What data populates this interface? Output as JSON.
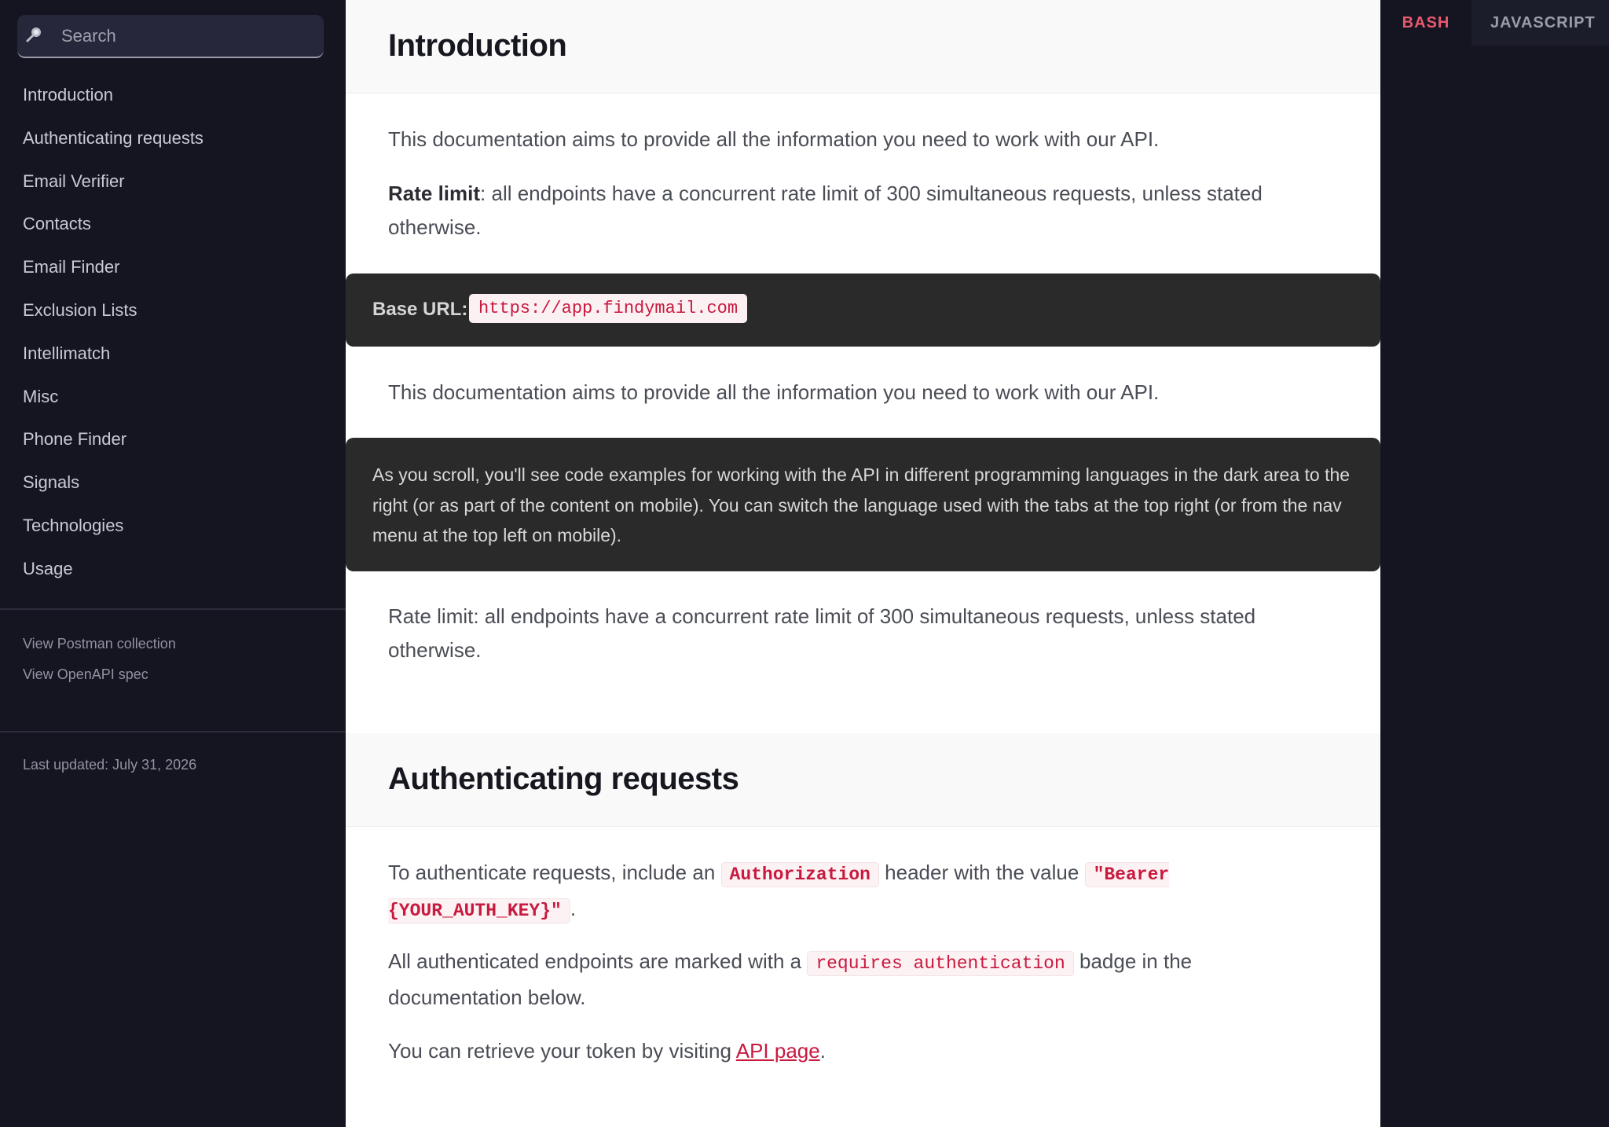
{
  "sidebar": {
    "search_placeholder": "Search",
    "items": [
      {
        "label": "Introduction"
      },
      {
        "label": "Authenticating requests"
      },
      {
        "label": "Email Verifier"
      },
      {
        "label": "Contacts"
      },
      {
        "label": "Email Finder"
      },
      {
        "label": "Exclusion Lists"
      },
      {
        "label": "Intellimatch"
      },
      {
        "label": "Misc"
      },
      {
        "label": "Phone Finder"
      },
      {
        "label": "Signals"
      },
      {
        "label": "Technologies"
      },
      {
        "label": "Usage"
      }
    ],
    "links": {
      "postman": "View Postman collection",
      "openapi": "View OpenAPI spec"
    },
    "last_updated": "Last updated: July 31, 2026"
  },
  "intro": {
    "title": "Introduction",
    "p1": "This documentation aims to provide all the information you need to work with our API.",
    "rate_bold": "Rate limit",
    "rate_rest": ": all endpoints have a concurrent rate limit of 300 simultaneous requests, unless stated otherwise.",
    "base_url_label": "Base URL:",
    "base_url": "https://app.findymail.com",
    "p2": "This documentation aims to provide all the information you need to work with our API.",
    "note": "As you scroll, you'll see code examples for working with the API in different programming languages in the dark area to the right (or as part of the content on mobile). You can switch the language used with the tabs at the top right (or from the nav menu at the top left on mobile).",
    "rate_plain": "Rate limit: all endpoints have a concurrent rate limit of 300 simultaneous requests, unless stated otherwise."
  },
  "auth": {
    "title": "Authenticating requests",
    "p1_a": "To authenticate requests, include an ",
    "p1_code1": "Authorization",
    "p1_b": " header with the value ",
    "p1_code2": "\"Bearer {YOUR_AUTH_KEY}\"",
    "p1_c": ".",
    "p2_a": "All authenticated endpoints are marked with a ",
    "p2_code": "requires authentication",
    "p2_b": " badge in the documentation below.",
    "p3_a": "You can retrieve your token by visiting ",
    "p3_link": "API page",
    "p3_b": "."
  },
  "code_tabs": {
    "bash": "BASH",
    "javascript": "JAVASCRIPT"
  },
  "colors": {
    "sidebar_bg": "#141521",
    "accent_red": "#c8193f",
    "tab_active": "#e9596f",
    "callout_bg": "#2a2a2a"
  }
}
